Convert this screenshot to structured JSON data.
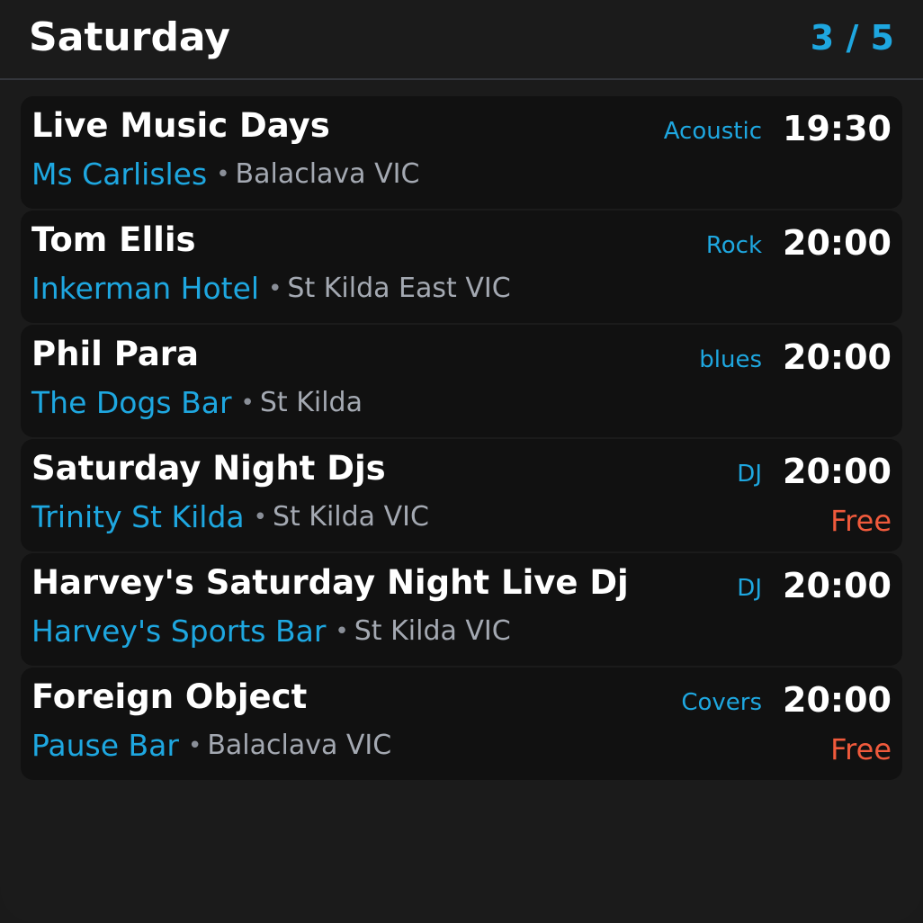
{
  "header": {
    "day": "Saturday",
    "pager": "3 / 5"
  },
  "colors": {
    "accent": "#1ea7e0",
    "price": "#f05a3c",
    "background": "#1b1b1b",
    "card": "#111111"
  },
  "events": [
    {
      "title": "Live Music Days",
      "genre": "Acoustic",
      "time": "19:30",
      "venue": "Ms Carlisles",
      "separator": "•",
      "location": "Balaclava VIC",
      "price": ""
    },
    {
      "title": "Tom Ellis",
      "genre": "Rock",
      "time": "20:00",
      "venue": "Inkerman Hotel",
      "separator": "•",
      "location": "St Kilda East VIC",
      "price": ""
    },
    {
      "title": "Phil Para",
      "genre": "blues",
      "time": "20:00",
      "venue": "The Dogs Bar",
      "separator": "•",
      "location": "St Kilda",
      "price": ""
    },
    {
      "title": "Saturday Night Djs",
      "genre": "DJ",
      "time": "20:00",
      "venue": "Trinity St Kilda",
      "separator": "•",
      "location": "St Kilda VIC",
      "price": "Free"
    },
    {
      "title": "Harvey's Saturday Night Live Dj",
      "genre": "DJ",
      "time": "20:00",
      "venue": "Harvey's Sports Bar",
      "separator": "•",
      "location": "St Kilda VIC",
      "price": ""
    },
    {
      "title": "Foreign Object",
      "genre": "Covers",
      "time": "20:00",
      "venue": "Pause Bar",
      "separator": "•",
      "location": "Balaclava VIC",
      "price": "Free"
    }
  ]
}
